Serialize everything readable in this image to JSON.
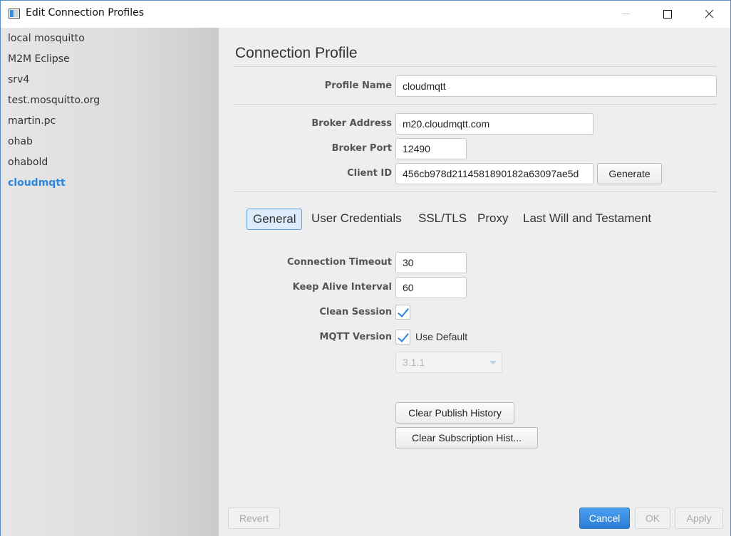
{
  "window": {
    "title": "Edit Connection Profiles"
  },
  "sidebar": {
    "profiles": [
      "local mosquitto",
      "M2M Eclipse",
      "srv4",
      "test.mosquitto.org",
      "martin.pc",
      "ohab",
      "ohabold",
      "cloudmqtt"
    ],
    "selected": "cloudmqtt"
  },
  "main": {
    "heading": "Connection Profile",
    "profile_name": {
      "label": "Profile Name",
      "value": "cloudmqtt"
    },
    "broker_address": {
      "label": "Broker Address",
      "value": "m20.cloudmqtt.com"
    },
    "broker_port": {
      "label": "Broker Port",
      "value": "12490"
    },
    "client_id": {
      "label": "Client ID",
      "value": "456cb978d2114581890182a63097ae5d",
      "generate_label": "Generate"
    },
    "tabs": [
      "General",
      "User Credentials",
      "SSL/TLS",
      "Proxy",
      "Last Will and Testament"
    ],
    "active_tab": "General",
    "general": {
      "connection_timeout": {
        "label": "Connection Timeout",
        "value": "30"
      },
      "keep_alive": {
        "label": "Keep Alive Interval",
        "value": "60"
      },
      "clean_session": {
        "label": "Clean Session",
        "checked": true
      },
      "mqtt_version": {
        "label": "MQTT Version",
        "use_default_label": "Use Default",
        "use_default_checked": true,
        "version": "3.1.1"
      },
      "clear_publish_label": "Clear Publish History",
      "clear_subscription_label": "Clear Subscription Hist..."
    }
  },
  "footer": {
    "revert": "Revert",
    "cancel": "Cancel",
    "ok": "OK",
    "apply": "Apply"
  }
}
